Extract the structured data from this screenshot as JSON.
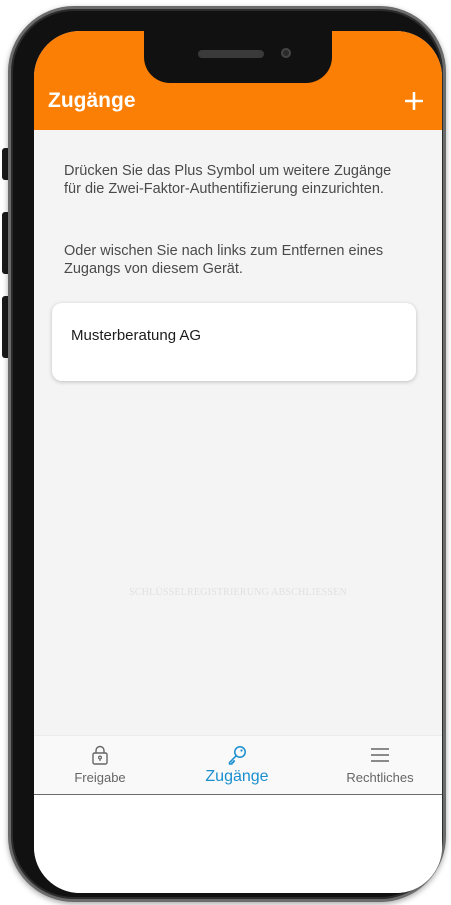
{
  "app_bar": {
    "title": "Zugänge",
    "add_button_icon": "plus-icon",
    "background_color": "#fb7e05"
  },
  "main": {
    "hint_add": "Drücken Sie das Plus Symbol um weitere Zugänge für die Zwei-Faktor-Authentifizierung einzurichten.",
    "hint_remove": "Oder wischen Sie nach links zum Entfernen eines Zugangs von diesem Gerät.",
    "accounts": [
      {
        "name": "Musterberatung AG"
      }
    ],
    "watermark": "SCHLÜSSELREGISTRIERUNG ABSCHLIESSEN"
  },
  "bottom_nav": {
    "items": [
      {
        "label": "Freigabe",
        "icon": "lock-icon",
        "active": false
      },
      {
        "label": "Zugänge",
        "icon": "key-icon",
        "active": true
      },
      {
        "label": "Rechtliches",
        "icon": "menu-icon",
        "active": false
      }
    ],
    "active_color": "#1a8fcf"
  }
}
